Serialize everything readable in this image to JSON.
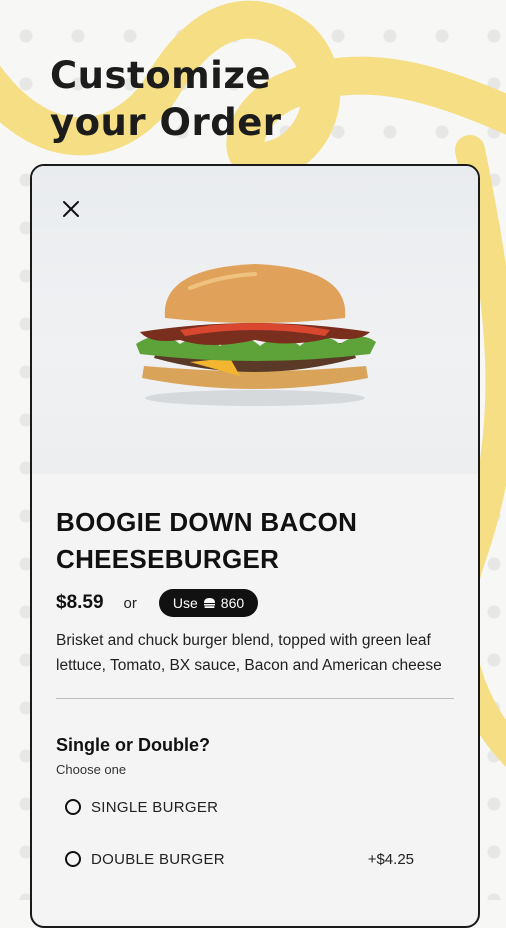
{
  "page": {
    "headline_line1": "Customize",
    "headline_line2": "your Order"
  },
  "product": {
    "name_line1": "BOOGIE DOWN BACON",
    "name_line2": "CHEESEBURGER",
    "price": "$8.59",
    "or_text": "or",
    "points_use_label": "Use",
    "points_value": "860",
    "description": "Brisket and chuck burger blend, topped with green leaf lettuce, Tomato, BX sauce, Bacon and American cheese"
  },
  "options": {
    "title": "Single or Double?",
    "subtitle": "Choose one",
    "items": [
      {
        "label": "SINGLE BURGER",
        "price": ""
      },
      {
        "label": "DOUBLE BURGER",
        "price": "+$4.25"
      }
    ]
  },
  "icons": {
    "close": "close-icon",
    "points": "burger-coin-icon",
    "hero": "burger-photo"
  },
  "colors": {
    "accent_yellow": "#f6de84",
    "pill_bg": "#111111",
    "text": "#111111"
  }
}
